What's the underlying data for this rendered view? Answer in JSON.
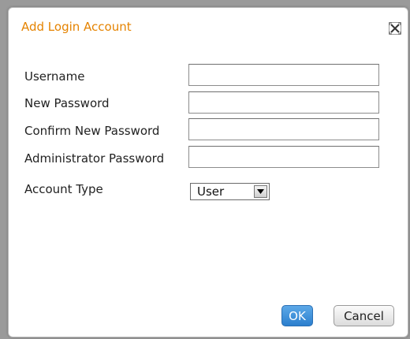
{
  "dialog": {
    "title": "Add Login Account",
    "close_icon": "close-icon",
    "title_color": "#e58300"
  },
  "form": {
    "fields": [
      {
        "label": "Username",
        "value": ""
      },
      {
        "label": "New Password",
        "value": ""
      },
      {
        "label": "Confirm New Password",
        "value": ""
      },
      {
        "label": "Administrator Password",
        "value": ""
      }
    ],
    "account_type": {
      "label": "Account Type",
      "selected": "User"
    }
  },
  "buttons": {
    "ok_label": "OK",
    "cancel_label": "Cancel",
    "ok_color": "#2b7fce"
  }
}
